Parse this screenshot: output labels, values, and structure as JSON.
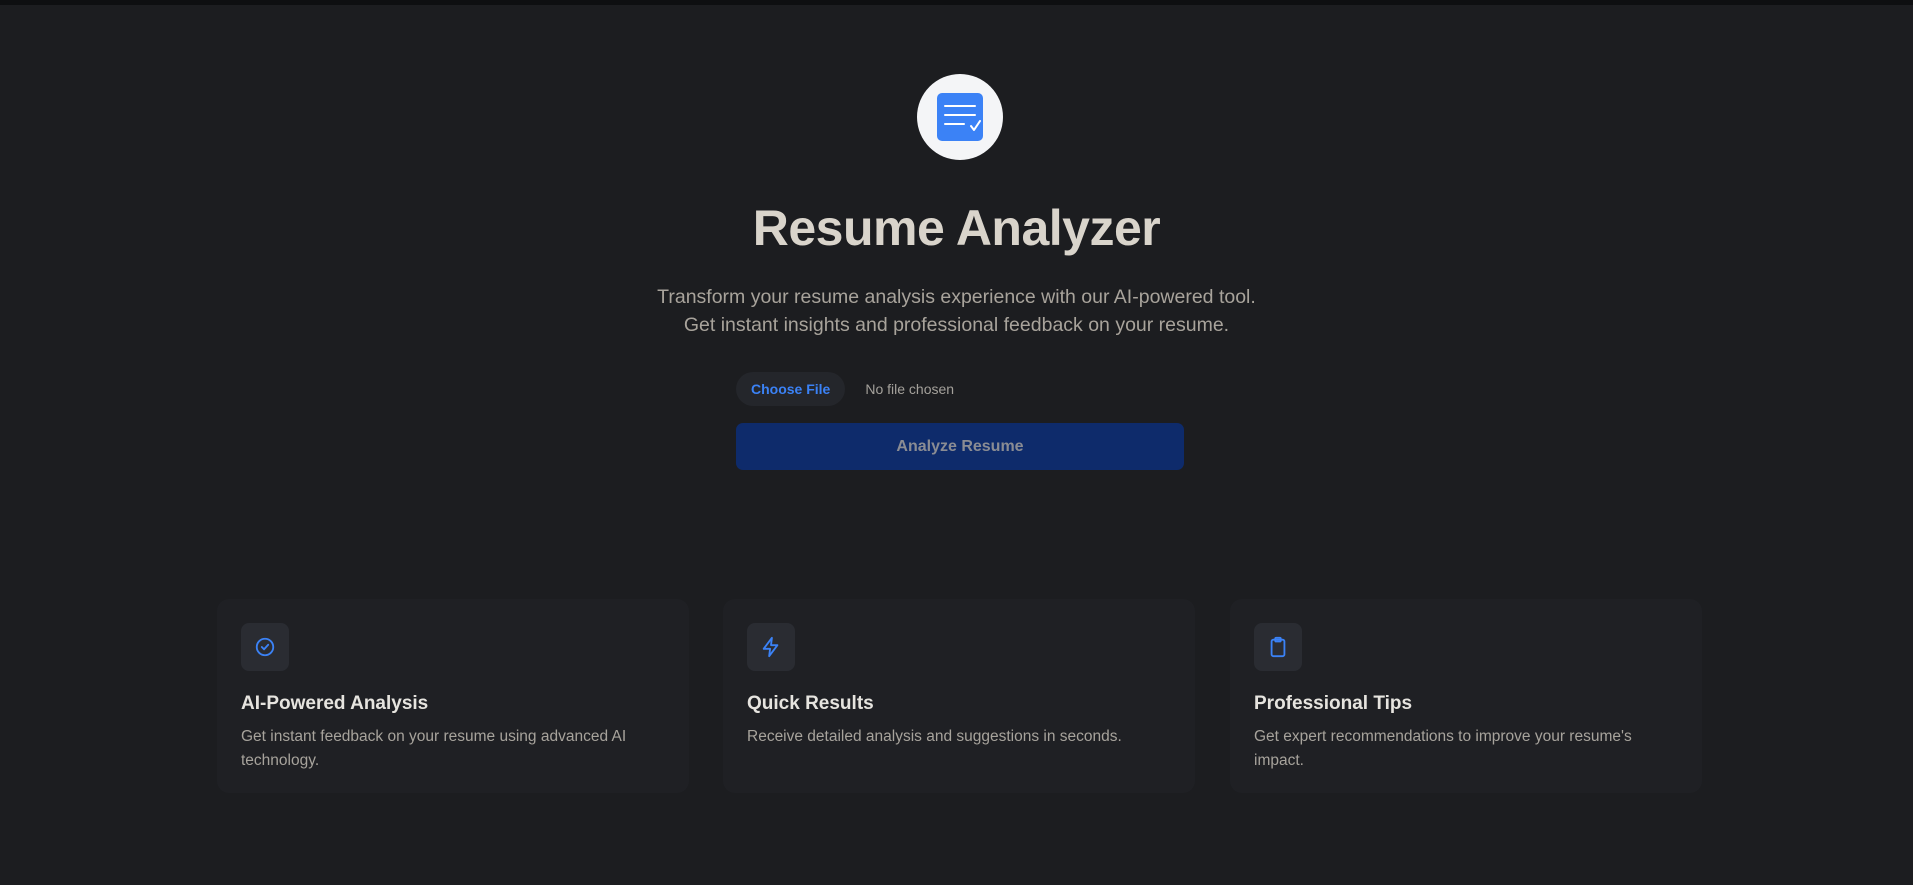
{
  "colors": {
    "background": "#1c1d20",
    "accent": "#3b82f6",
    "button_disabled": "#0e2b6b",
    "card": "#1f2024"
  },
  "header": {
    "logo_icon": "document-check-icon",
    "title": "Resume Analyzer",
    "subtitle_line1": "Transform your resume analysis experience with our AI-powered tool.",
    "subtitle_line2": "Get instant insights and professional feedback on your resume."
  },
  "upload": {
    "choose_label": "Choose File",
    "status": "No file chosen",
    "analyze_label": "Analyze Resume"
  },
  "features": [
    {
      "icon": "check-circle-icon",
      "title": "AI-Powered Analysis",
      "text": "Get instant feedback on your resume using advanced AI technology."
    },
    {
      "icon": "lightning-bolt-icon",
      "title": "Quick Results",
      "text": "Receive detailed analysis and suggestions in seconds."
    },
    {
      "icon": "clipboard-icon",
      "title": "Professional Tips",
      "text": "Get expert recommendations to improve your resume's impact."
    }
  ]
}
